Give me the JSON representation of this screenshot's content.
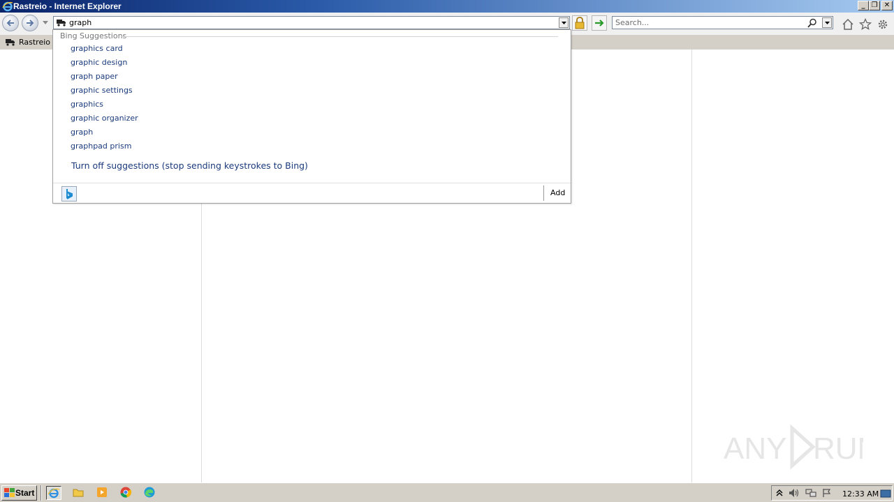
{
  "window": {
    "title": "Rastreio - Internet Explorer",
    "minimize_label": "_",
    "restore_label": "❐",
    "close_label": "✕"
  },
  "toolbar": {
    "address_value": "graph",
    "search_placeholder": "Search..."
  },
  "tabs": [
    {
      "label": "Rastreio",
      "icon": "truck-icon"
    }
  ],
  "suggestions": {
    "header": "Bing Suggestions",
    "items": [
      "graphics card",
      "graphic design",
      "graph paper",
      "graphic settings",
      "graphics",
      "graphic organizer",
      "graph",
      "graphpad prism"
    ],
    "turn_off_label": "Turn off suggestions (stop sending keystrokes to Bing)",
    "add_label": "Add"
  },
  "taskbar": {
    "start_label": "Start",
    "clock": "12:33 AM"
  },
  "watermark": {
    "text_left": "ANY",
    "text_right": "RUN"
  },
  "colors": {
    "suggestion_text": "#1a3a7c",
    "title_gradient_start": "#0a246a",
    "taskbar_bg": "#d4d0c8"
  }
}
